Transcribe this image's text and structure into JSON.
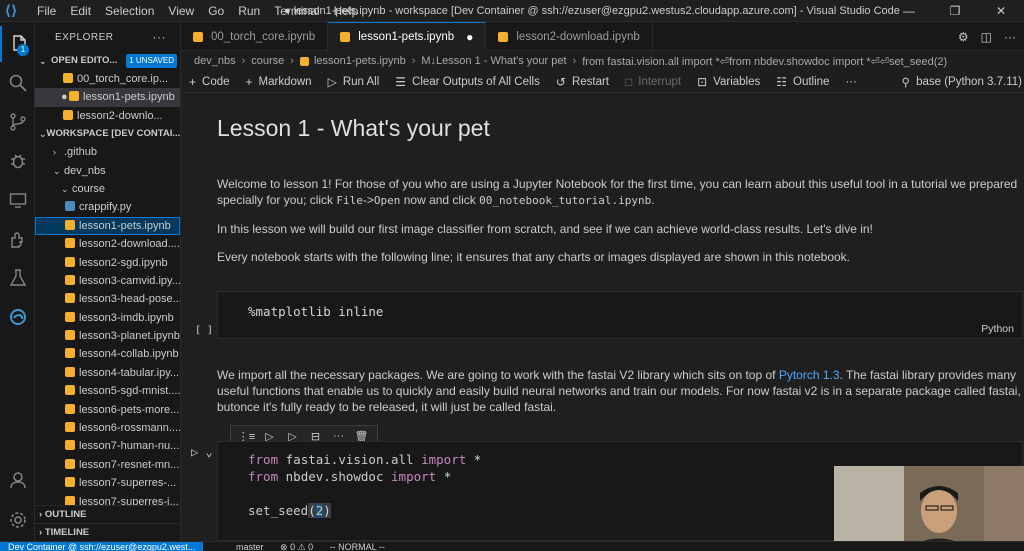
{
  "titlebar": {
    "menu": [
      "File",
      "Edit",
      "Selection",
      "View",
      "Go",
      "Run",
      "Terminal",
      "Help"
    ],
    "title": "● lesson1-pets.ipynb - workspace [Dev Container @ ssh://ezuser@ezgpu2.westus2.cloudapp.azure.com] - Visual Studio Code"
  },
  "activity": {
    "explorer_badge": "1"
  },
  "sidebar": {
    "header": "EXPLORER",
    "open_editors": {
      "label": "OPEN EDITO...",
      "unsaved": "1 UNSAVED",
      "files": [
        "00_torch_core.ip...",
        "lesson1-pets.ipynb",
        "lesson2-downlo..."
      ]
    },
    "workspace": {
      "label": "WORKSPACE [DEV CONTAI...",
      "folders": [
        ".github",
        "dev_nbs",
        "course"
      ],
      "files": [
        "crappify.py",
        "lesson1-pets.ipynb",
        "lesson2-download....",
        "lesson2-sgd.ipynb",
        "lesson3-camvid.ipy...",
        "lesson3-head-pose....",
        "lesson3-imdb.ipynb",
        "lesson3-planet.ipynb",
        "lesson4-collab.ipynb",
        "lesson4-tabular.ipy...",
        "lesson5-sgd-mnist....",
        "lesson6-pets-more....",
        "lesson6-rossmann....",
        "lesson7-human-nu...",
        "lesson7-resnet-mn...",
        "lesson7-superres-...",
        "lesson7-superres-i..."
      ]
    },
    "outline": "OUTLINE",
    "timeline": "TIMELINE"
  },
  "tabs": [
    {
      "label": "00_torch_core.ipynb",
      "active": false
    },
    {
      "label": "lesson1-pets.ipynb",
      "active": true,
      "modified": "●"
    },
    {
      "label": "lesson2-download.ipynb",
      "active": false
    }
  ],
  "breadcrumb": [
    "dev_nbs",
    "course",
    "lesson1-pets.ipynb",
    "M↓Lesson 1 - What's your pet",
    "from fastai.vision.all import *⏎from nbdev.showdoc import *⏎⏎set_seed(2)"
  ],
  "toolbar": {
    "code": "Code",
    "markdown": "Markdown",
    "run_all": "Run All",
    "clear": "Clear Outputs of All Cells",
    "restart": "Restart",
    "interrupt": "Interrupt",
    "variables": "Variables",
    "outline": "Outline",
    "more": "···",
    "kernel": "base (Python 3.7.11)"
  },
  "notebook": {
    "heading": "Lesson 1 - What's your pet",
    "p1_a": "Welcome to lesson 1! For those of you who are using a Jupyter Notebook for the first time, you can learn about this useful tool in a tutorial we prepared specially for you; click ",
    "p1_code1": "File",
    "p1_arrow": "->",
    "p1_code2": "Open",
    "p1_b": " now and click ",
    "p1_code3": "00_notebook_tutorial.ipynb",
    "p1_c": ".",
    "p2": "In this lesson we will build our first image classifier from scratch, and see if we can achieve world-class results. Let's dive in!",
    "p3": "Every notebook starts with the following line; it ensures that any charts or images displayed are shown in this notebook.",
    "cell1_code": "%matplotlib inline",
    "cell1_exec": "[ ]",
    "cell1_lang": "Python",
    "p4_a": "We import all the necessary packages. We are going to work with the fastai V2 library which sits on top of ",
    "p4_link": "Pytorch 1.3",
    "p4_b": ". The fastai library provides many useful functions that enable us to quickly and easily build neural networks and train our models. For now fastai v2 is in a separate package called fastai, butonce it's fully ready to be released, it will just be called fastai.",
    "cell2": {
      "kw_from": "from",
      "mod1": "fastai.vision.all",
      "kw_import": "import",
      "star": "*",
      "mod2": "nbdev.showdoc",
      "fn": "set_seed",
      "open": "(",
      "arg": "2",
      "close": ")"
    }
  },
  "status": {
    "remote": "Dev Container @ ssh://ezuser@ezgpu2.west...",
    "branch": "master",
    "errors": "⊗ 0 ⚠ 0",
    "mode": "-- NORMAL --"
  }
}
